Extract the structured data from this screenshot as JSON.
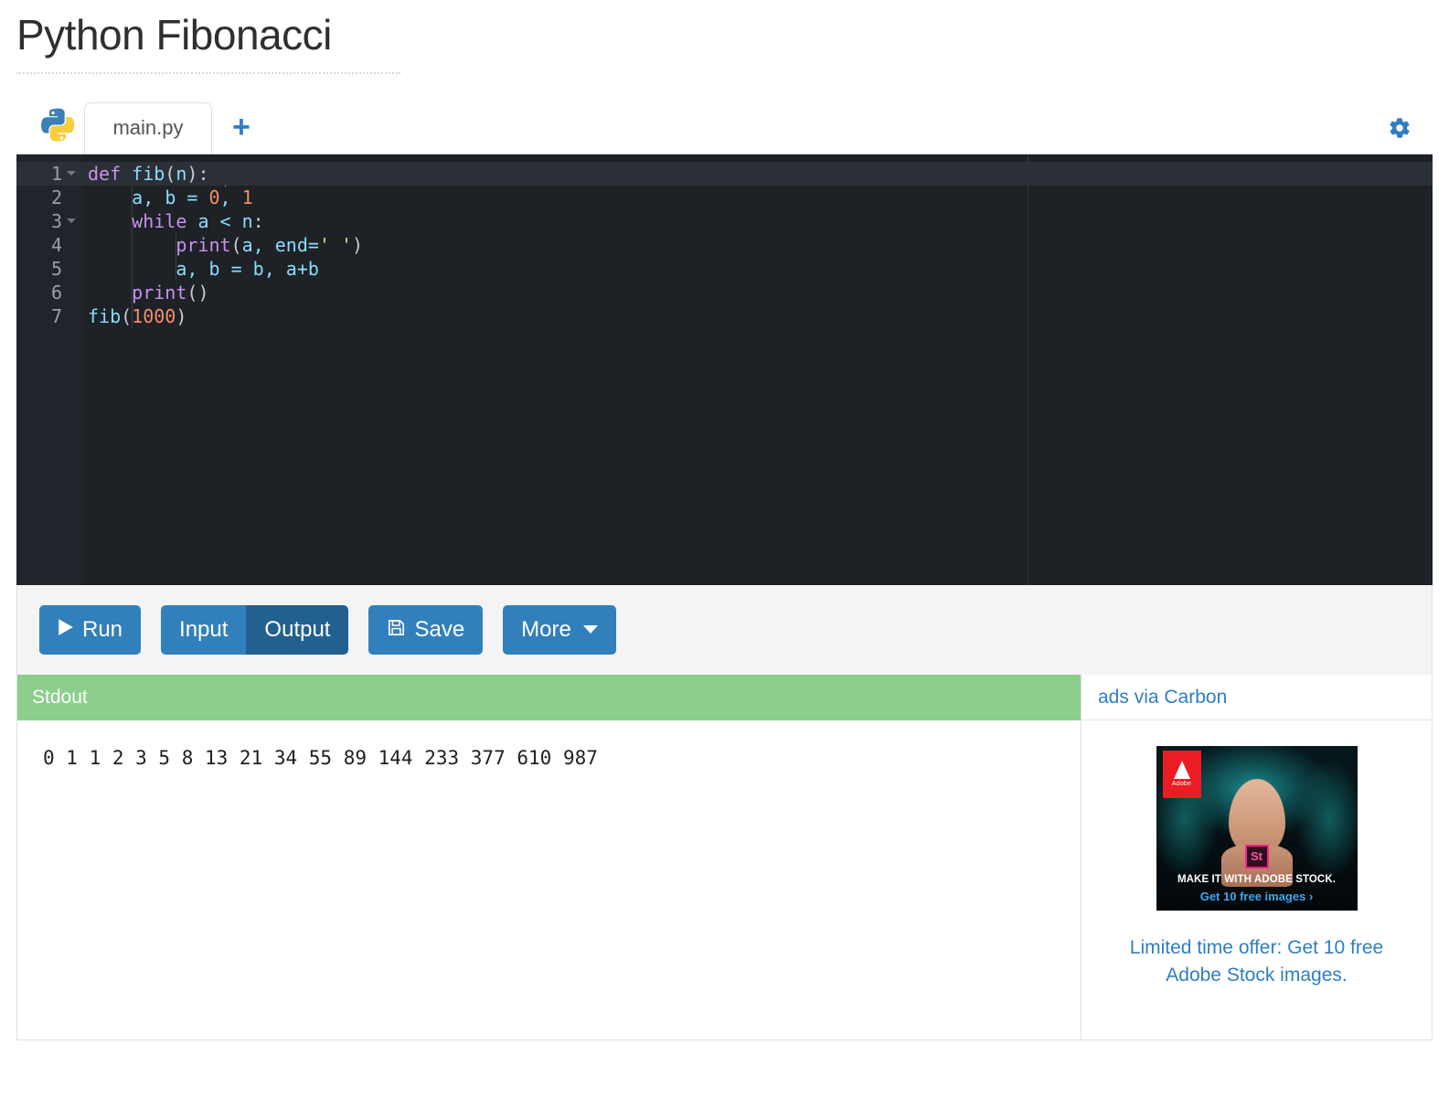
{
  "header": {
    "title": "Python Fibonacci"
  },
  "editor": {
    "language_icon": "python-logo-icon",
    "tabs": [
      {
        "label": "main.py",
        "active": true
      }
    ],
    "add_tab_label": "+",
    "settings_icon": "gear-icon",
    "lines": [
      {
        "number": "1",
        "foldable": true,
        "active": true
      },
      {
        "number": "2",
        "foldable": false,
        "active": false
      },
      {
        "number": "3",
        "foldable": true,
        "active": false
      },
      {
        "number": "4",
        "foldable": false,
        "active": false
      },
      {
        "number": "5",
        "foldable": false,
        "active": false
      },
      {
        "number": "6",
        "foldable": false,
        "active": false
      },
      {
        "number": "7",
        "foldable": false,
        "active": false
      }
    ],
    "code": [
      "def fib(n):",
      "    a, b = 0, 1",
      "    while a < n:",
      "        print(a, end=' ')",
      "        a, b = b, a+b",
      "    print()",
      "fib(1000)"
    ]
  },
  "toolbar": {
    "run_label": "Run",
    "run_icon": "play-icon",
    "input_label": "Input",
    "output_label": "Output",
    "output_active": true,
    "save_label": "Save",
    "save_icon": "floppy-disk-icon",
    "more_label": "More",
    "more_icon": "caret-down-icon"
  },
  "output": {
    "panel_title": "Stdout",
    "panel_title_bg": "#8ccf8c",
    "stdout_text": "0 1 1 2 3 5 8 13 21 34 55 89 144 233 377 610 987 "
  },
  "ads": {
    "header_label": "ads via Carbon",
    "creative": {
      "brand": "Adobe",
      "product_mark": "St",
      "headline": "MAKE IT WITH ADOBE STOCK.",
      "cta": "Get 10 free images ›"
    },
    "caption": "Limited time offer: Get 10 free Adobe Stock images."
  },
  "colors": {
    "accent_blue": "#3280bb",
    "accent_blue_active": "#22608f",
    "stdout_green": "#8ccf8c",
    "editor_bg": "#1e2126",
    "link_blue": "#2f7ec4"
  }
}
